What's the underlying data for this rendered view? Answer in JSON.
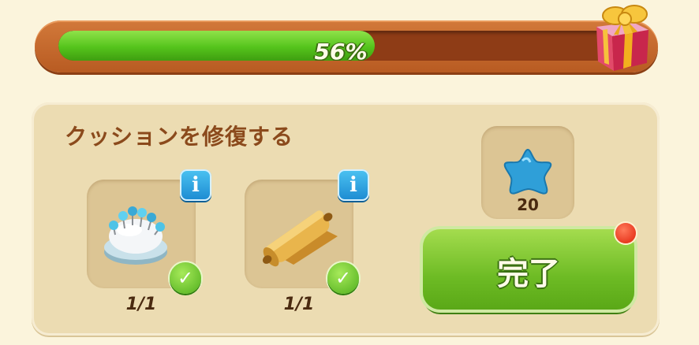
{
  "progress": {
    "percent_label": "56%",
    "fraction": 0.56,
    "reward_icon": "gift-box-icon"
  },
  "task": {
    "title": "クッションを修復する"
  },
  "items": [
    {
      "icon": "pin-cushion-icon",
      "count": "1/1",
      "info_label": "i",
      "complete": true
    },
    {
      "icon": "fabric-roll-icon",
      "count": "1/1",
      "info_label": "i",
      "complete": true
    }
  ],
  "reward": {
    "icon": "blue-star-icon",
    "value": "20"
  },
  "complete_button": {
    "label": "完了"
  },
  "colors": {
    "accent_green": "#6dbb24",
    "info_blue": "#1c8ad1",
    "title_brown": "#8b4a1c"
  }
}
